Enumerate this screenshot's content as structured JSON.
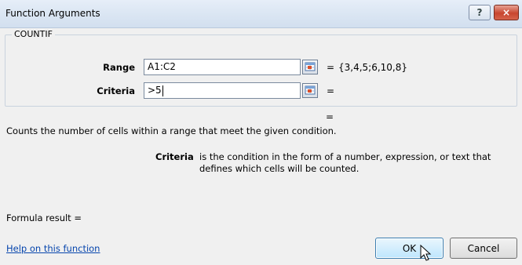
{
  "window": {
    "title": "Function Arguments",
    "help_glyph": "?",
    "close_glyph": "×"
  },
  "function_name": "COUNTIF",
  "arguments": [
    {
      "label": "Range",
      "value": "A1:C2",
      "equals": "=",
      "result": "{3,4,5;6,10,8}"
    },
    {
      "label": "Criteria",
      "value": ">5",
      "equals": "=",
      "result": ""
    }
  ],
  "overall_equals": "=",
  "description": "Counts the number of cells within a range that meet the given condition.",
  "arg_help": {
    "name": "Criteria",
    "text": "is the condition in the form of a number, expression, or text that defines which cells will be counted."
  },
  "formula_result_label": "Formula result =",
  "help_link": "Help on this function",
  "buttons": {
    "ok": "OK",
    "cancel": "Cancel"
  }
}
